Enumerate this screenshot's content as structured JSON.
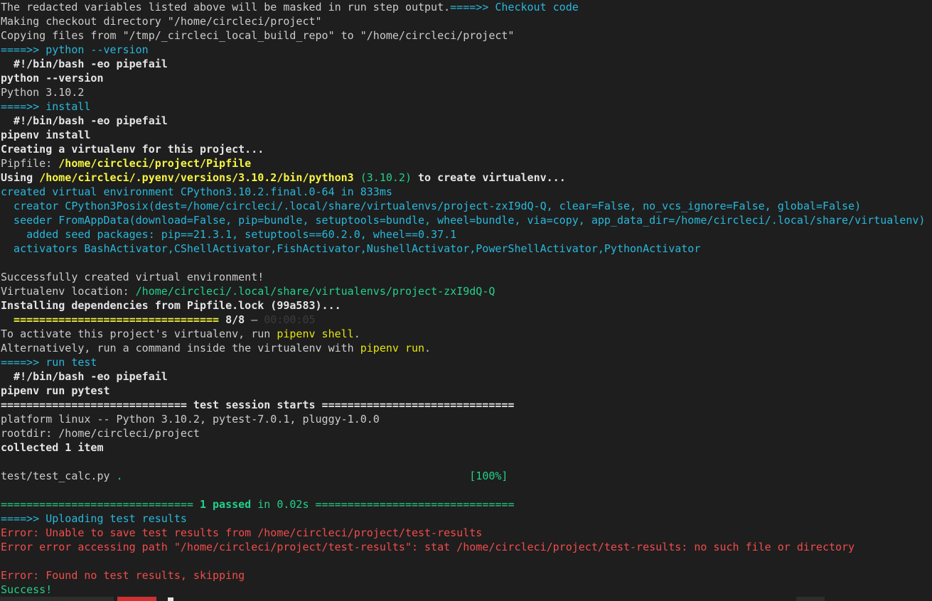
{
  "terminal": {
    "lines": [
      [
        {
          "text": "The redacted variables listed above will be masked in run step output.",
          "cls": "c-default"
        },
        {
          "text": "====>> Checkout code",
          "cls": "c-cyan"
        }
      ],
      [
        {
          "text": "Making checkout directory \"/home/circleci/project\"",
          "cls": "c-default"
        }
      ],
      [
        {
          "text": "Copying files from \"/tmp/_circleci_local_build_repo\" to \"/home/circleci/project\"",
          "cls": "c-default"
        }
      ],
      [
        {
          "text": "====>> python --version",
          "cls": "c-cyan"
        }
      ],
      [
        {
          "text": "  #!/bin/bash -eo pipefail",
          "cls": "c-bold"
        }
      ],
      [
        {
          "text": "python --version",
          "cls": "c-bold"
        }
      ],
      [
        {
          "text": "Python 3.10.2",
          "cls": "c-default"
        }
      ],
      [
        {
          "text": "====>> install",
          "cls": "c-cyan"
        }
      ],
      [
        {
          "text": "  #!/bin/bash -eo pipefail",
          "cls": "c-bold"
        }
      ],
      [
        {
          "text": "pipenv install",
          "cls": "c-bold"
        }
      ],
      [
        {
          "text": "Creating a virtualenv for this project...",
          "cls": "c-bold"
        }
      ],
      [
        {
          "text": "Pipfile: ",
          "cls": "c-default"
        },
        {
          "text": "/home/circleci/project/Pipfile",
          "cls": "c-yellow-bold"
        }
      ],
      [
        {
          "text": "Using ",
          "cls": "c-bold"
        },
        {
          "text": "/home/circleci/.pyenv/versions/3.10.2/bin/python3",
          "cls": "c-yellow-bold"
        },
        {
          "text": " ",
          "cls": "c-bold"
        },
        {
          "text": "(3.10.2)",
          "cls": "c-green"
        },
        {
          "text": " to create virtualenv...",
          "cls": "c-bold"
        }
      ],
      [
        {
          "text": "created virtual environment CPython3.10.2.final.0-64 in 833ms",
          "cls": "c-cyan"
        }
      ],
      [
        {
          "text": "  creator CPython3Posix(dest=/home/circleci/.local/share/virtualenvs/project-zxI9dQ-Q, clear=False, no_vcs_ignore=False, global=False)",
          "cls": "c-cyan"
        }
      ],
      [
        {
          "text": "  seeder FromAppData(download=False, pip=bundle, setuptools=bundle, wheel=bundle, via=copy, app_data_dir=/home/circleci/.local/share/virtualenv)",
          "cls": "c-cyan"
        }
      ],
      [
        {
          "text": "    added seed packages: pip==21.3.1, setuptools==60.2.0, wheel==0.37.1",
          "cls": "c-cyan"
        }
      ],
      [
        {
          "text": "  activators BashActivator,CShellActivator,FishActivator,NushellActivator,PowerShellActivator,PythonActivator",
          "cls": "c-cyan"
        }
      ],
      [
        {
          "text": "",
          "cls": "c-default"
        }
      ],
      [
        {
          "text": "Successfully created virtual environment!",
          "cls": "c-default"
        }
      ],
      [
        {
          "text": "Virtualenv location: ",
          "cls": "c-default"
        },
        {
          "text": "/home/circleci/.local/share/virtualenvs/project-zxI9dQ-Q",
          "cls": "c-green"
        }
      ],
      [
        {
          "text": "Installing dependencies from Pipfile.lock (99a583)...",
          "cls": "c-bold"
        }
      ],
      [
        {
          "text": "  ================================ ",
          "cls": "c-yellow-bold"
        },
        {
          "text": "8/8",
          "cls": "c-bold"
        },
        {
          "text": " — ",
          "cls": "c-default"
        },
        {
          "text": "00:00:05",
          "cls": "c-dark"
        }
      ],
      [
        {
          "text": "To activate this project's virtualenv, run ",
          "cls": "c-default"
        },
        {
          "text": "pipenv shell",
          "cls": "c-yellow"
        },
        {
          "text": ".",
          "cls": "c-default"
        }
      ],
      [
        {
          "text": "Alternatively, run a command inside the virtualenv with ",
          "cls": "c-default"
        },
        {
          "text": "pipenv run",
          "cls": "c-yellow"
        },
        {
          "text": ".",
          "cls": "c-default"
        }
      ],
      [
        {
          "text": "====>> run test",
          "cls": "c-cyan"
        }
      ],
      [
        {
          "text": "  #!/bin/bash -eo pipefail",
          "cls": "c-bold"
        }
      ],
      [
        {
          "text": "pipenv run pytest",
          "cls": "c-bold"
        }
      ],
      [
        {
          "text": "============================= test session starts ==============================",
          "cls": "c-bold"
        }
      ],
      [
        {
          "text": "platform linux -- Python 3.10.2, pytest-7.0.1, pluggy-1.0.0",
          "cls": "c-default"
        }
      ],
      [
        {
          "text": "rootdir: /home/circleci/project",
          "cls": "c-default"
        }
      ],
      [
        {
          "text": "collected 1 item",
          "cls": "c-bold"
        }
      ],
      [
        {
          "text": "",
          "cls": "c-default"
        }
      ],
      [
        {
          "text": "test/test_calc.py ",
          "cls": "c-default"
        },
        {
          "text": ".",
          "cls": "c-green"
        },
        {
          "text": "                                                      ",
          "cls": "c-default"
        },
        {
          "text": "[100%]",
          "cls": "c-green"
        }
      ],
      [
        {
          "text": "",
          "cls": "c-default"
        }
      ],
      [
        {
          "text": "============================== ",
          "cls": "c-green"
        },
        {
          "text": "1 passed",
          "cls": "c-green-bold"
        },
        {
          "text": " in 0.02s ",
          "cls": "c-green"
        },
        {
          "text": "===============================",
          "cls": "c-green"
        }
      ],
      [
        {
          "text": "====>> Uploading test results",
          "cls": "c-cyan"
        }
      ],
      [
        {
          "text": "Error: Unable to save test results from /home/circleci/project/test-results",
          "cls": "c-red"
        }
      ],
      [
        {
          "text": "Error error accessing path \"/home/circleci/project/test-results\": stat /home/circleci/project/test-results: no such file or directory",
          "cls": "c-red"
        }
      ],
      [
        {
          "text": "",
          "cls": "c-default"
        }
      ],
      [
        {
          "text": "Error: Found no test results, skipping",
          "cls": "c-red"
        }
      ],
      [
        {
          "text": "Success!",
          "cls": "c-green"
        }
      ]
    ]
  }
}
